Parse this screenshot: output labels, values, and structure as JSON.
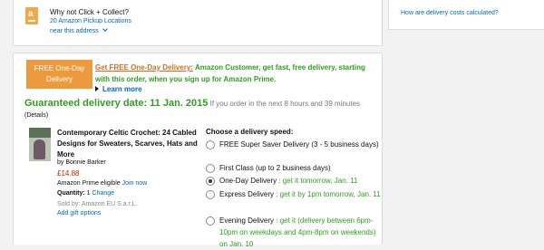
{
  "pickup": {
    "why_text": "Why not Click + Collect?",
    "locations_link": "20 Amazon Pickup Locations",
    "near_link": "near this address"
  },
  "help": {
    "delivery_cost_link": "How are delivery costs calculated?"
  },
  "promo": {
    "badge_line1": "FREE One-Day",
    "badge_line2": "Delivery",
    "link_text": "Get FREE One-Day Delivery:",
    "message": " Amazon Customer, get fast, free delivery, starting with this order, when you sign up for Amazon Prime.",
    "learn_more": "Learn more"
  },
  "delivery": {
    "guaranteed": "Guaranteed delivery date: 11 Jan. 2015",
    "guaranteed_sub": " If you order in the next 8 hours and 39 minutes",
    "details": "(Details)"
  },
  "product": {
    "title": "Contemporary Celtic Crochet: 24 Cabled Designs for Sweaters, Scarves, Hats and More",
    "byline": "by Bonnie Barker",
    "price": "£14.88",
    "prime_text": "Amazon Prime eligible ",
    "join_now": "Join now",
    "quantity_label": "Quantity: ",
    "quantity_value": "1",
    "change_link": " Change",
    "sold_by": "Sold by: Amazon EU S.a.r.L.",
    "gift_link": "Add gift options"
  },
  "speeds": {
    "heading": "Choose a delivery speed:",
    "options": [
      {
        "label": "FREE Super Saver Delivery (3 - 5 business days)",
        "note": "",
        "selected": false
      },
      {
        "label": "First Class (up to 2 business days)",
        "note": "",
        "selected": false
      },
      {
        "label": "One-Day Delivery",
        "note": " : get it tomorrow, Jan. 11",
        "selected": true
      },
      {
        "label": "Express Delivery",
        "note": " : get it by 1pm tomorrow, Jan. 11",
        "selected": false
      },
      {
        "label": "Evening Delivery",
        "note": " : get it (delivery between 6pm-10pm on weekdays and 4pm-8pm on weekends) on Jan. 10",
        "selected": false
      }
    ]
  }
}
